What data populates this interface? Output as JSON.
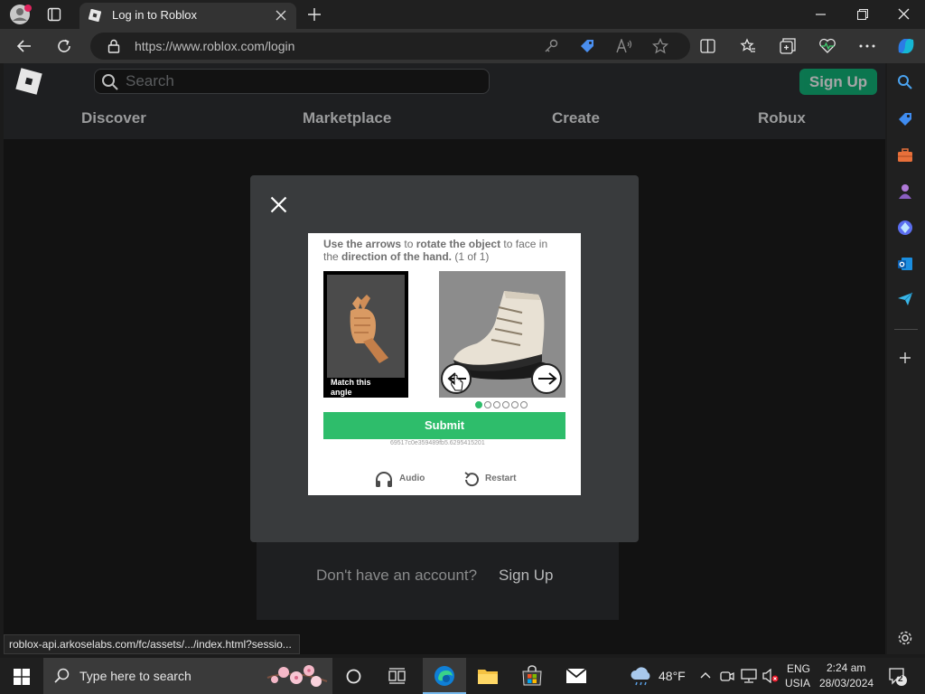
{
  "browser": {
    "tab_title": "Log in to Roblox",
    "url": "https://www.roblox.com/login",
    "status_url": "roblox-api.arkoselabs.com/fc/assets/.../index.html?sessio..."
  },
  "roblox": {
    "search_placeholder": "Search",
    "signup_button": "Sign Up",
    "nav": [
      "Discover",
      "Marketplace",
      "Create",
      "Robux"
    ],
    "no_account": "Don't have an account?",
    "no_account_link": "Sign Up"
  },
  "captcha": {
    "instr_1_bold": "Use the arrows",
    "instr_1_mid": " to ",
    "instr_1_bold2": "rotate the object",
    "instr_1_end": " to face in",
    "instr_2_start": "the ",
    "instr_2_bold": "direction of the hand.",
    "instr_2_end": " (1 of 1)",
    "match_label": "Match this angle",
    "submit": "Submit",
    "session_id": "69517c0e359489fb5.6295415201",
    "audio": "Audio",
    "restart": "Restart",
    "dots_total": 6,
    "dot_active": 1,
    "accent_color": "#2ebd6b"
  },
  "taskbar": {
    "search_placeholder": "Type here to search",
    "weather_temp": "48°F",
    "lang_1": "ENG",
    "lang_2": "USIA",
    "time": "2:24 am",
    "date": "28/03/2024",
    "notif_count": "2"
  }
}
